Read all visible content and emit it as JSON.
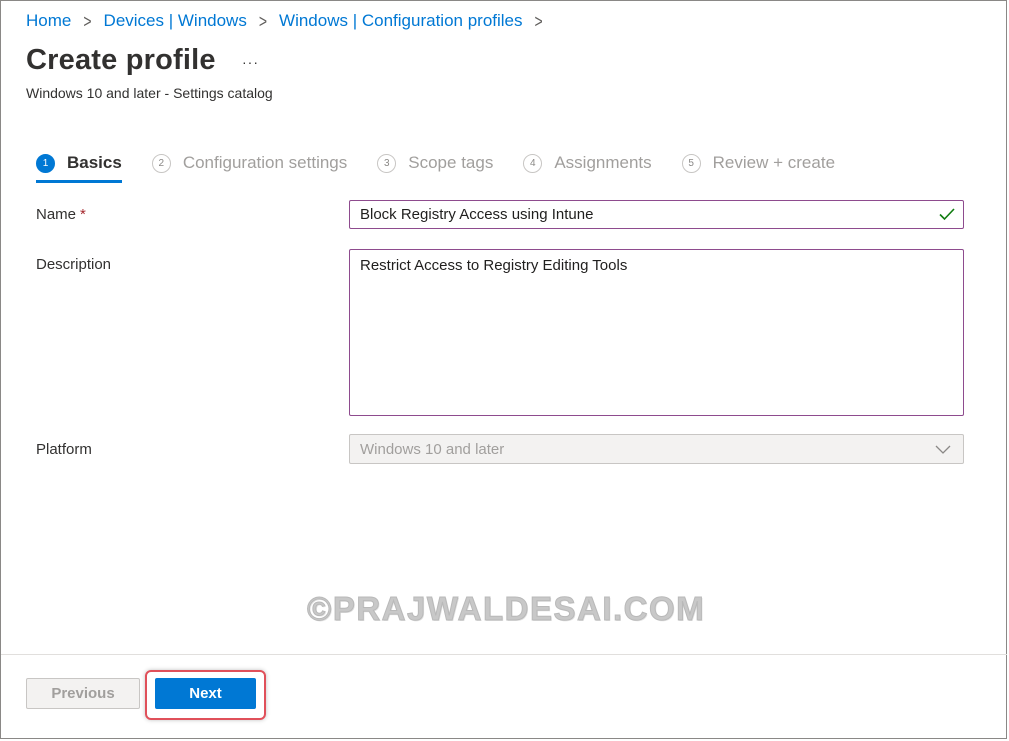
{
  "breadcrumb": [
    {
      "label": "Home"
    },
    {
      "label": "Devices | Windows"
    },
    {
      "label": "Windows | Configuration profiles"
    }
  ],
  "page": {
    "title": "Create profile",
    "more_label": "···",
    "subtitle": "Windows 10 and later - Settings catalog"
  },
  "steps": [
    {
      "num": "1",
      "label": "Basics",
      "active": true
    },
    {
      "num": "2",
      "label": "Configuration settings",
      "active": false
    },
    {
      "num": "3",
      "label": "Scope tags",
      "active": false
    },
    {
      "num": "4",
      "label": "Assignments",
      "active": false
    },
    {
      "num": "5",
      "label": "Review + create",
      "active": false
    }
  ],
  "form": {
    "name_label": "Name",
    "required_mark": "*",
    "name_value": "Block Registry Access using Intune",
    "description_label": "Description",
    "description_value": "Restrict Access to Registry Editing Tools",
    "platform_label": "Platform",
    "platform_value": "Windows 10 and later"
  },
  "watermark": "©PRAJWALDESAI.COM",
  "footer": {
    "previous_label": "Previous",
    "next_label": "Next"
  },
  "colors": {
    "accent": "#0078d4",
    "input_border": "#8e4b8e",
    "highlight": "#e0505a",
    "valid": "#107c10"
  },
  "icons": {
    "breadcrumb_separator": "chevron-right-icon",
    "name_valid": "checkmark-icon",
    "platform_dropdown": "chevron-down-icon"
  }
}
